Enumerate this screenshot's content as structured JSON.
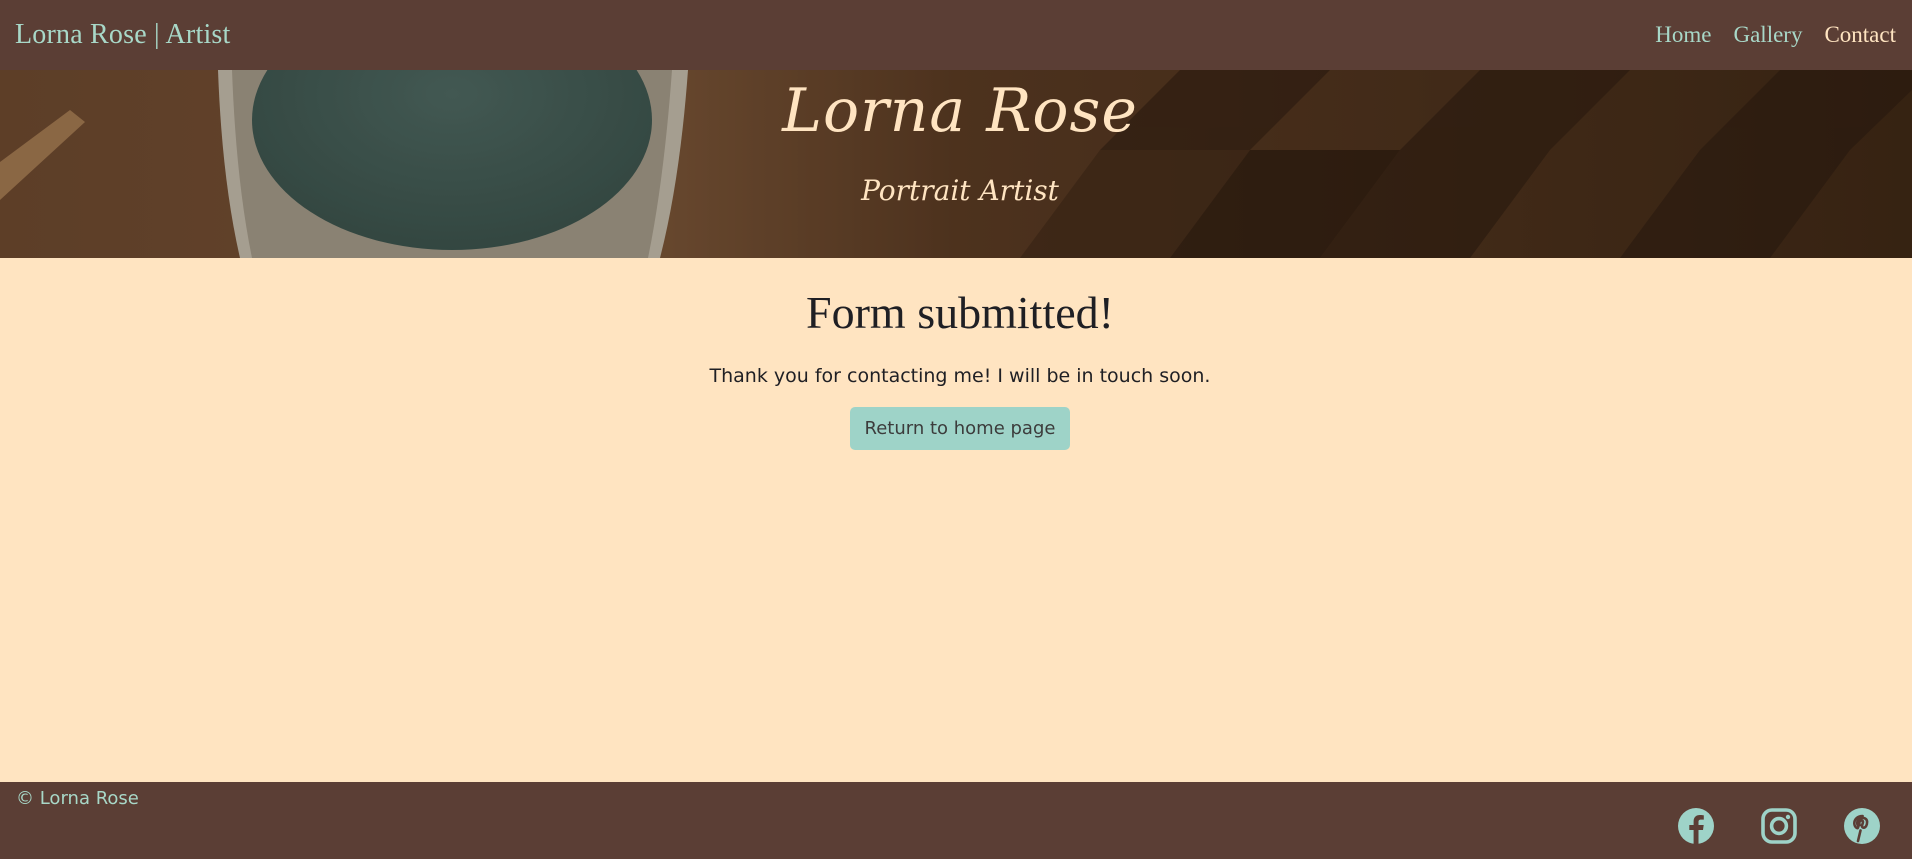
{
  "nav": {
    "brand": "Lorna Rose | Artist",
    "links": [
      {
        "label": "Home",
        "active": false
      },
      {
        "label": "Gallery",
        "active": false
      },
      {
        "label": "Contact",
        "active": true
      }
    ]
  },
  "hero": {
    "title": "Lorna Rose",
    "subtitle": "Portrait Artist"
  },
  "main": {
    "heading": "Form submitted!",
    "message": "Thank you for contacting me! I will be in touch soon.",
    "button_label": "Return to home page"
  },
  "footer": {
    "copyright": "© Lorna Rose",
    "social_icons": [
      "facebook-icon",
      "instagram-icon",
      "pinterest-icon"
    ]
  },
  "colors": {
    "nav_bg": "#5b3e35",
    "page_bg": "#ffe4c1",
    "accent": "#a8d8c8",
    "button_bg": "#9ed3c8"
  }
}
